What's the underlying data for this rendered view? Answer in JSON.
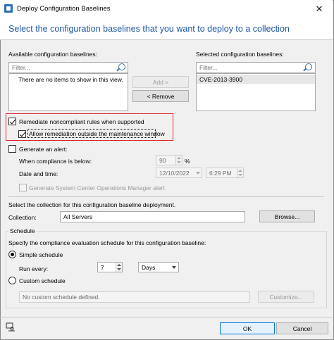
{
  "window": {
    "title": "Deploy Configuration Baselines",
    "close_glyph": "✕",
    "heading": "Select the configuration baselines that you want to deploy to a collection"
  },
  "available": {
    "label": "Available configuration baselines:",
    "filter_placeholder": "Filter...",
    "empty_text": "There are no items to show in this view."
  },
  "selected": {
    "label": "Selected configuration baselines:",
    "filter_placeholder": "Filter...",
    "items": [
      "CVE-2013-3900"
    ]
  },
  "transfer": {
    "add_label": "Add >",
    "remove_label": "< Remove"
  },
  "remediation": {
    "remediate_label": "Remediate noncompliant rules when supported",
    "remediate_checked": true,
    "allow_outside_label": "Allow remediation outside the maintenance window",
    "allow_outside_checked": true
  },
  "alert": {
    "label": "Generate an alert:",
    "checked": false,
    "compliance_label": "When compliance is below:",
    "compliance_value": "90",
    "percent_sign": "%",
    "datetime_label": "Date and time:",
    "date_value": "12/10/2022",
    "time_value": "6:29 PM",
    "scom_label": "Generate System Center Operations Manager alert",
    "scom_checked": false
  },
  "collection": {
    "instruction": "Select the collection for this configuration baseline deployment.",
    "label": "Collection:",
    "value": "All Servers",
    "browse_label": "Browse..."
  },
  "schedule": {
    "group_label": "Schedule",
    "instruction": "Specify the compliance evaluation schedule for this configuration baseline:",
    "simple_label": "Simple schedule",
    "simple_selected": true,
    "run_every_label": "Run every:",
    "run_every_value": "7",
    "unit_value": "Days",
    "custom_label": "Custom schedule",
    "custom_selected": false,
    "custom_text": "No custom schedule defined.",
    "customize_label": "Customize..."
  },
  "footer": {
    "ok_label": "OK",
    "cancel_label": "Cancel"
  },
  "colors": {
    "heading": "#1f57a6",
    "highlight": "#e0242c",
    "primary_border": "#0078d7"
  }
}
